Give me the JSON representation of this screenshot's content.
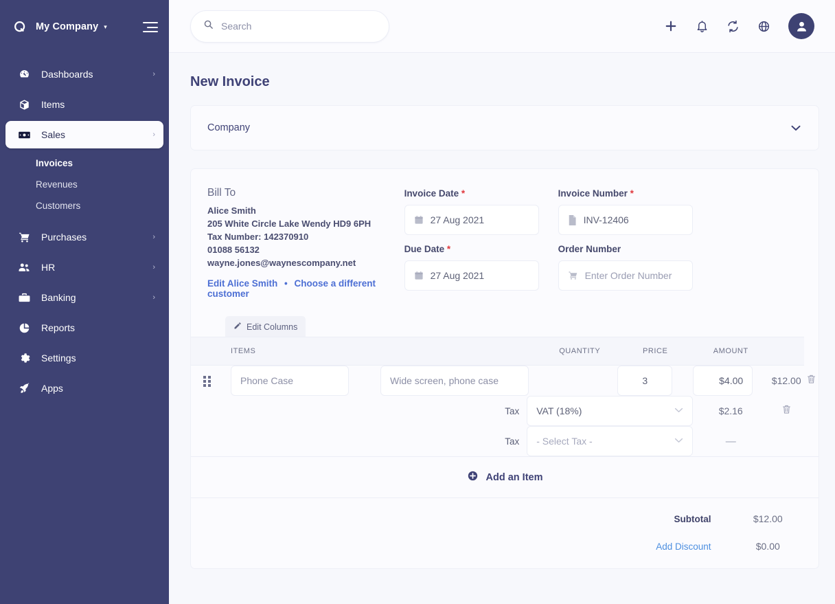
{
  "sidebar": {
    "brand": {
      "name": "My Company",
      "logo_icon": "app-logo-icon",
      "caret": "▾",
      "menu_toggle_icon": "hamburger-icon"
    },
    "items": [
      {
        "label": "Dashboards",
        "icon": "dashboard-gauge-icon",
        "chevron": "›",
        "active": false
      },
      {
        "label": "Items",
        "icon": "box-icon",
        "chevron": "",
        "active": false
      },
      {
        "label": "Sales",
        "icon": "banknote-icon",
        "chevron": "›",
        "active": true
      },
      {
        "label": "Purchases",
        "icon": "shopping-cart-icon",
        "chevron": "›",
        "active": false
      },
      {
        "label": "HR",
        "icon": "users-icon",
        "chevron": "›",
        "active": false
      },
      {
        "label": "Banking",
        "icon": "briefcase-icon",
        "chevron": "›",
        "active": false
      },
      {
        "label": "Reports",
        "icon": "pie-chart-icon",
        "chevron": "",
        "active": false
      },
      {
        "label": "Settings",
        "icon": "gear-icon",
        "chevron": "",
        "active": false
      },
      {
        "label": "Apps",
        "icon": "rocket-icon",
        "chevron": "",
        "active": false
      }
    ],
    "sales_submenu": [
      {
        "label": "Invoices",
        "current": true
      },
      {
        "label": "Revenues",
        "current": false
      },
      {
        "label": "Customers",
        "current": false
      }
    ]
  },
  "topbar": {
    "search": {
      "placeholder": "Search",
      "value": "",
      "icon": "search-icon"
    },
    "icons": [
      {
        "name": "plus-icon",
        "glyph": "+"
      },
      {
        "name": "bell-icon",
        "glyph": "\u0000"
      },
      {
        "name": "refresh-icon",
        "glyph": "\u0000"
      },
      {
        "name": "help-circle-icon",
        "glyph": "\u0000"
      }
    ],
    "avatar": {
      "name": "user-avatar",
      "icon": "person-icon"
    }
  },
  "page": {
    "title": "New Invoice",
    "company_section": {
      "label": "Company",
      "caret": "⌄"
    }
  },
  "bill_to": {
    "heading": "Bill To",
    "customer_name": "Alice Smith",
    "address": "205 White Circle Lake Wendy HD9 6PH",
    "tax_number": "Tax Number: 142370910",
    "phone": "01088 56132",
    "email": "wayne.jones@waynescompany.net",
    "edit_link": "Edit Alice Smith",
    "separator": "•",
    "choose_link": "Choose a different customer"
  },
  "invoice_fields": [
    {
      "label": "Invoice Date",
      "required": true,
      "value": "27 Aug 2021",
      "placeholder": "",
      "icon": "calendar-icon",
      "muted": false
    },
    {
      "label": "Invoice Number",
      "required": true,
      "value": "INV-12406",
      "placeholder": "",
      "icon": "document-icon",
      "muted": false
    },
    {
      "label": "Due Date",
      "required": true,
      "value": "27 Aug 2021",
      "placeholder": "",
      "icon": "calendar-icon",
      "muted": false
    },
    {
      "label": "Order Number",
      "required": false,
      "value": "",
      "placeholder": "Enter Order Number",
      "icon": "cart-icon",
      "muted": true
    }
  ],
  "required_marker": "*",
  "items_table": {
    "edit_columns_label": "Edit Columns",
    "edit_columns_icon": "pencil-icon",
    "headers": {
      "items": "ITEMS",
      "quantity": "QUANTITY",
      "price": "PRICE",
      "amount": "AMOUNT"
    },
    "rows": [
      {
        "type": "item",
        "handle_icon": "drag-handle-icon",
        "name_placeholder": "Phone Case",
        "name_value": "",
        "description_placeholder": "Wide screen, phone case",
        "description_value": "",
        "quantity": "3",
        "price": "$4.00",
        "amount": "$12.00",
        "delete_icon": "trash-icon"
      },
      {
        "type": "tax",
        "label": "Tax",
        "select_value": "VAT (18%)",
        "is_placeholder": false,
        "amount": "$2.16",
        "delete_icon": "trash-icon"
      },
      {
        "type": "tax",
        "label": "Tax",
        "select_value": "- Select Tax -",
        "is_placeholder": true,
        "amount": "—",
        "delete_icon": ""
      }
    ],
    "add_item_label": "Add an Item",
    "add_item_icon": "plus-circle-icon"
  },
  "totals": [
    {
      "label": "Subtotal",
      "value": "$12.00",
      "is_link": false
    },
    {
      "label": "Add Discount",
      "value": "$0.00",
      "is_link": true
    }
  ],
  "colors": {
    "sidebar_bg": "#3e4273",
    "page_bg": "#f7f8fc",
    "panel_bg": "#fbfbfe",
    "accent_link": "#4d6fd4",
    "discount_link": "#4d8fe0",
    "required_red": "#e0393e",
    "heading": "#3f4276"
  }
}
